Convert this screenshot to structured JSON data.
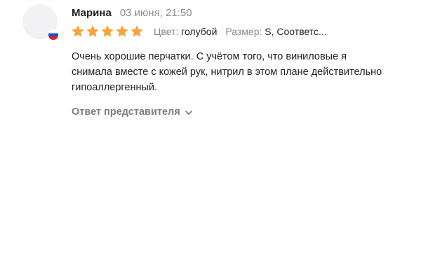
{
  "review": {
    "author": "Марина",
    "date": "03 июня, 21:50",
    "rating": 5,
    "rating_max": 5,
    "star_color": "#f8a33c",
    "avatar_flag": "russia-flag-icon",
    "color": {
      "label": "Цвет:",
      "value": "голубой"
    },
    "size": {
      "label": "Размер:",
      "value": "S, Соответс..."
    },
    "text": "Очень хорошие перчатки. С учётом того, что виниловые я снимала вместе с кожей рук, нитрил в этом плане действительно гипоаллергенный.",
    "reply_toggle": {
      "label": "Ответ представителя",
      "icon": "chevron-down-icon"
    }
  }
}
